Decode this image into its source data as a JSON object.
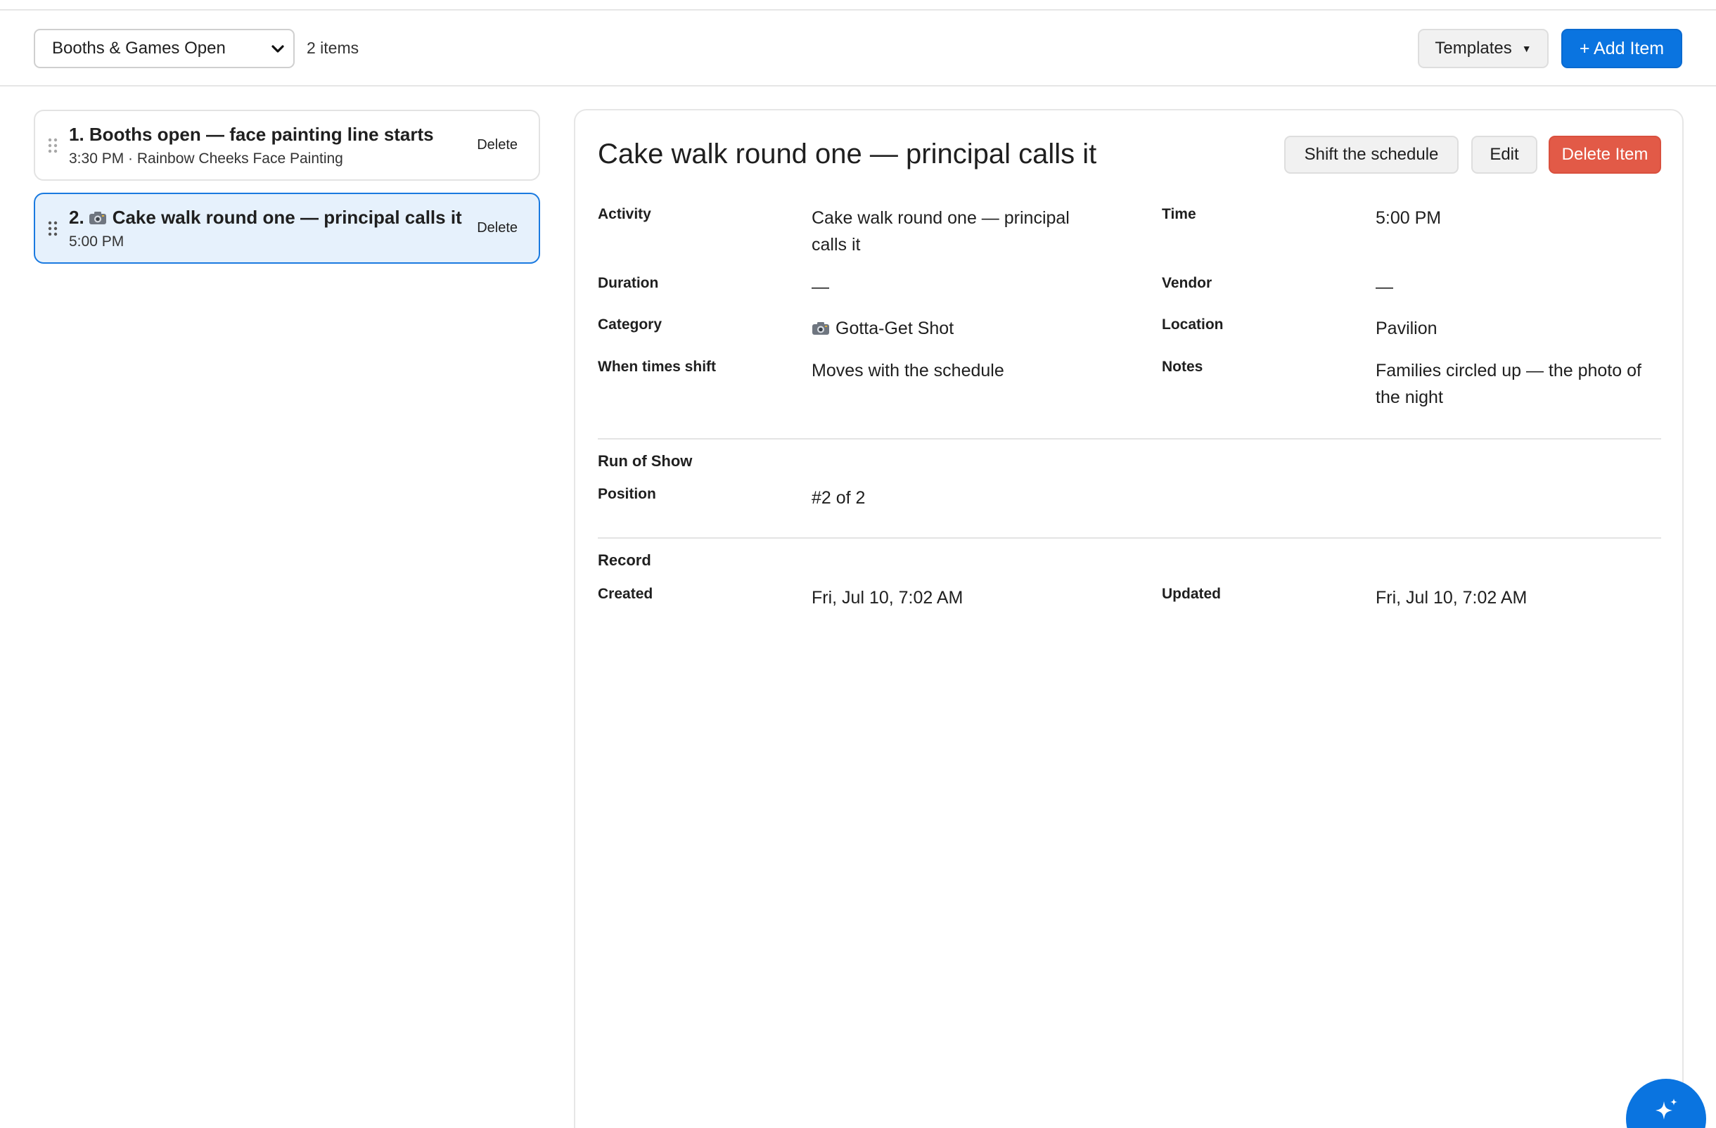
{
  "toolbar": {
    "section_select": "Booths & Games Open",
    "item_count": "2 items",
    "templates_label": "Templates",
    "templates_caret": "▼",
    "add_label": "+ Add Item"
  },
  "list": [
    {
      "title": "1. Booths open — face painting line starts",
      "subtitle": "3:30 PM · Rainbow Cheeks Face Painting",
      "delete_label": "Delete",
      "selected": false
    },
    {
      "number": "2.",
      "icon": "camera-icon",
      "title_text": "Cake walk round one — principal calls it",
      "subtitle": "5:00 PM",
      "delete_label": "Delete",
      "selected": true
    }
  ],
  "detail": {
    "title": "Cake walk round one — principal calls it",
    "shift_label": "Shift the schedule",
    "edit_label": "Edit",
    "delete_label": "Delete Item",
    "fields": {
      "activity_label": "Activity",
      "activity_line1": "Cake walk round one — principal",
      "activity_line2": "calls it",
      "time_label": "Time",
      "time_value": "5:00 PM",
      "duration_label": "Duration",
      "duration_value": "—",
      "vendor_label": "Vendor",
      "vendor_value": "—",
      "category_label": "Category",
      "category_icon": "camera-icon",
      "category_value": "Gotta-Get Shot",
      "location_label": "Location",
      "location_value": "Pavilion",
      "shift_label": "When times shift",
      "shift_value": "Moves with the schedule",
      "notes_label": "Notes",
      "notes_line1": "Families circled up — the photo of",
      "notes_line2": "the night"
    },
    "run_of_show": {
      "heading": "Run of Show",
      "position_label": "Position",
      "position_value": "#2 of 2"
    },
    "record": {
      "heading": "Record",
      "created_label": "Created",
      "created_value": "Fri, Jul 10, 7:02 AM",
      "updated_label": "Updated",
      "updated_value": "Fri, Jul 10, 7:02 AM"
    }
  },
  "fab": {
    "icon": "sparkle-icon"
  },
  "colors": {
    "accent": "#0a74e0",
    "danger": "#e25a47",
    "selected_bg": "#e6f1fc",
    "selected_border": "#1a7ae0"
  }
}
